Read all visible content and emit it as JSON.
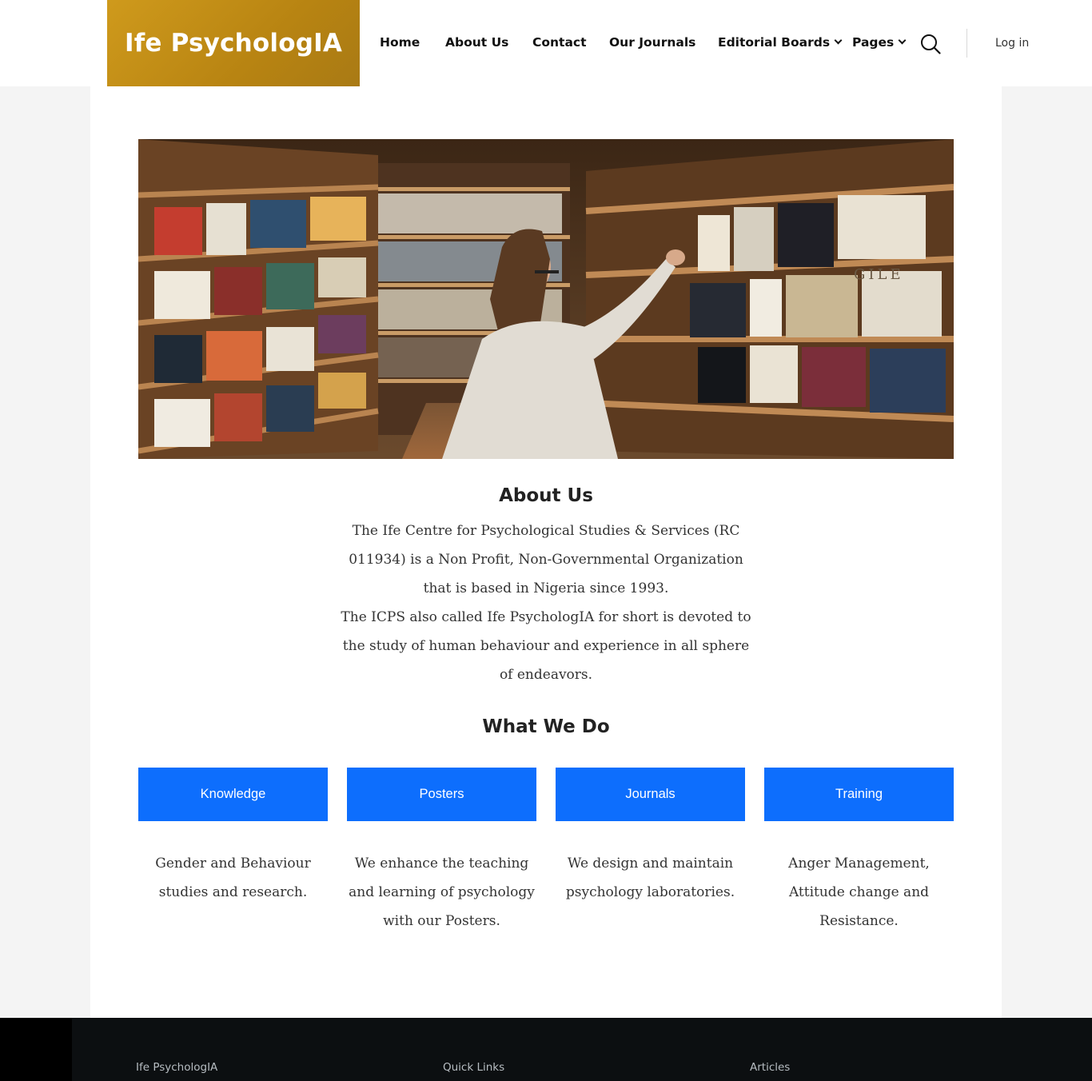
{
  "brand": {
    "name": "Ife PsychologIA",
    "accent": "#c48f17"
  },
  "nav": {
    "items": [
      {
        "label": "Home",
        "has_dropdown": false
      },
      {
        "label": "About Us",
        "has_dropdown": false
      },
      {
        "label": "Contact",
        "has_dropdown": false
      },
      {
        "label": "Our Journals",
        "has_dropdown": false
      },
      {
        "label": "Editorial Boards",
        "has_dropdown": true
      },
      {
        "label": "Pages",
        "has_dropdown": true
      }
    ],
    "search_icon": "search-icon",
    "login_label": "Log in"
  },
  "hero": {
    "icon": "hero-photo-library-bookshelves"
  },
  "about": {
    "title": "About Us",
    "paragraph1": "The Ife Centre for Psychological Studies & Services (RC 011934) is a Non Profit, Non-Governmental Organization that is based in Nigeria since 1993.",
    "paragraph2": "The ICPS also called Ife PsychologIA for short is devoted to the study of human behaviour and experience in all sphere of endeavors."
  },
  "what_we_do": {
    "title": "What We Do",
    "button_color": "#0d6efd",
    "cards": [
      {
        "label": "Knowledge",
        "text": "Gender and Behaviour studies and research."
      },
      {
        "label": "Posters",
        "text": "We enhance the teaching and learning of psychology with our Posters."
      },
      {
        "label": "Journals",
        "text": "We design and maintain psychology laboratories."
      },
      {
        "label": "Training",
        "text": "Anger Management, Attitude change and Resistance."
      }
    ]
  },
  "footer": {
    "col1": "Ife PsychologIA",
    "col2": "Quick Links",
    "col3": "Articles"
  }
}
